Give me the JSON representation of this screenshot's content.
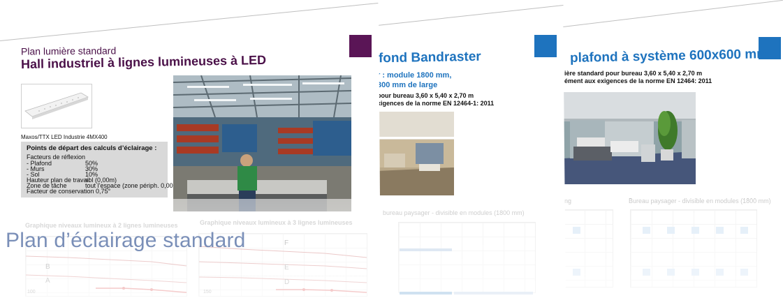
{
  "colors": {
    "purple_accent": "#5a1556",
    "blue_accent": "#1e73be",
    "overlay_text": "#7a8fb8",
    "heading_purple": "#4a1048"
  },
  "page1": {
    "kicker": "Plan lumière standard",
    "title": "Hall industriel à lignes lumineuses à LED",
    "product_caption": "Maxos/TTX LED Industrie 4MX400",
    "spec_heading": "Points de départ des calculs d’éclairage :",
    "spec_lines": [
      {
        "label": "Facteurs de réflexion",
        "value": ""
      },
      {
        "label": "- Plafond",
        "value": "50%"
      },
      {
        "label": "- Murs",
        "value": "30%"
      },
      {
        "label": "- Sol",
        "value": "10%"
      },
      {
        "label": "Hauteur plan de travail",
        "value": "sol (0,00m)"
      },
      {
        "label": "Zone de tâche",
        "value": "tout l’espace (zone périph. 0,00m)"
      },
      {
        "label": "Facteur de conservation 0,75°",
        "value": ""
      }
    ],
    "graph_title_left": "Graphique niveaux lumineux à 2 lignes lumineuses",
    "graph_title_right": "Graphique niveaux lumineux à 3 lignes lumineuses",
    "curve_labels_left": [
      "B",
      "A"
    ],
    "curve_labels_right": [
      "F",
      "E",
      "D"
    ],
    "axis_tick_left": "100",
    "axis_tick_right": "150"
  },
  "page2": {
    "title": "fond Bandraster",
    "subtitle_line1": "r : module 1800 mm,",
    "subtitle_line2": "300 mm de large",
    "line3": "pour bureau 3,60 x 5,40 x 2,70 m",
    "line4": "xigences de la norme EN 12464-1: 2011",
    "plan_caption": "bureau paysager - divisible en modules (1800 mm)"
  },
  "page3": {
    "title": "plafond à système 600x600 mm",
    "line1": "ière standard pour bureau 3,60 x 5,40 x 2,70 m",
    "line2": "ément aux exigences de la norme EN 12464: 2011",
    "left_fragment": "ing",
    "plan_caption": "Bureau paysager - divisible en modules (1800 mm)"
  },
  "overlay_title": "Plan d’éclairage standard"
}
